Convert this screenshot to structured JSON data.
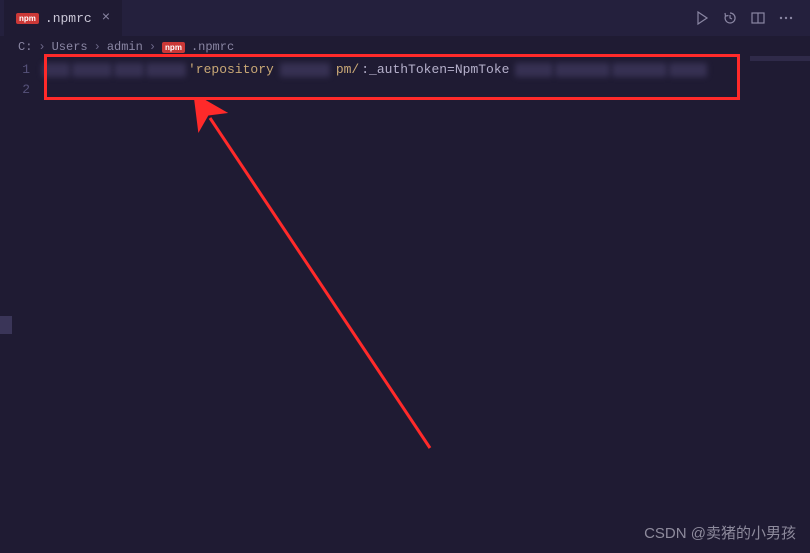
{
  "tab": {
    "icon_label": "npm",
    "filename": ".npmrc",
    "close_glyph": "×"
  },
  "toolbar": {
    "run": "▷",
    "history": "↺",
    "split": "⧉",
    "more": "…"
  },
  "breadcrumb": {
    "sep": "›",
    "parts": [
      "C:",
      "Users",
      "admin",
      ".npmrc"
    ],
    "file_icon": "npm"
  },
  "gutter": {
    "line1": "1",
    "line2": "2"
  },
  "code": {
    "seg_repo": "'repository",
    "seg_pm": "pm/",
    "seg_auth": ":_authToken=NpmToke"
  },
  "watermark": "CSDN @卖猪的小男孩"
}
